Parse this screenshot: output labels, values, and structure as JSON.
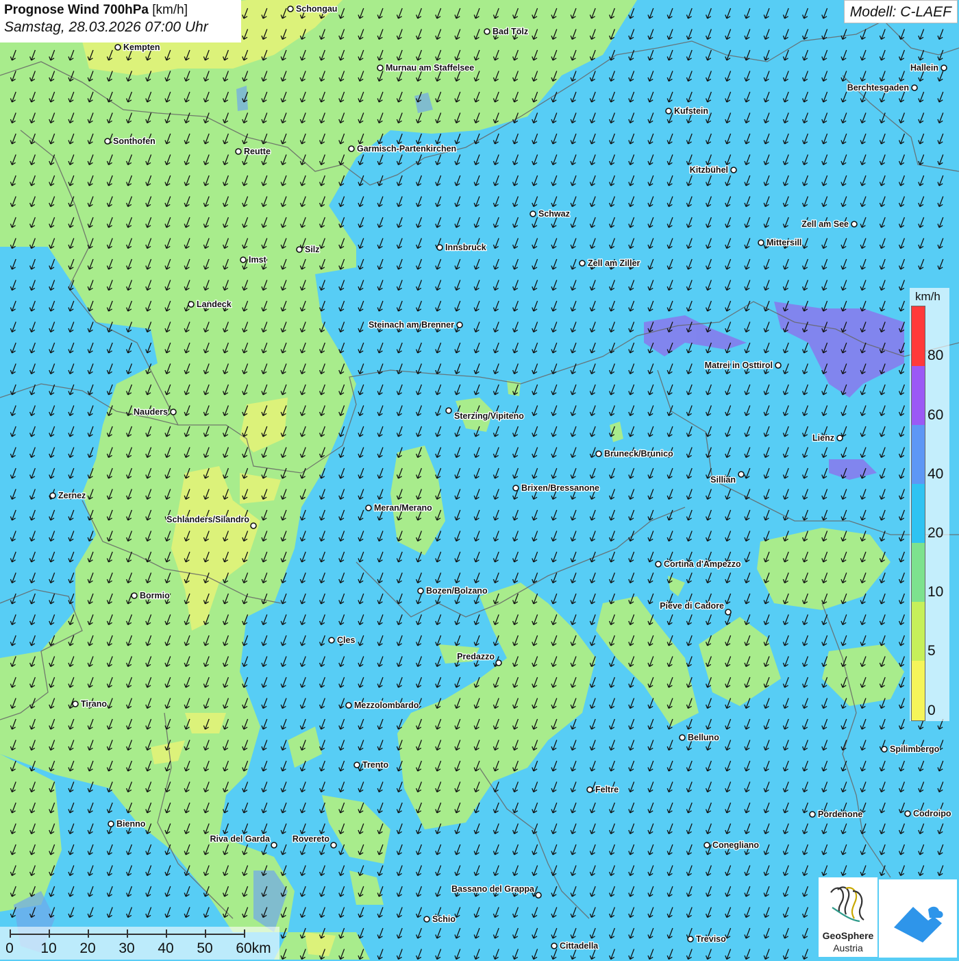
{
  "title": {
    "main": "Prognose Wind 700hPa",
    "unit": "[km/h]",
    "datetime": "Samstag, 28.03.2026 07:00 Uhr"
  },
  "model": "Modell: C-LAEF",
  "legend": {
    "unit": "km/h",
    "ticks": [
      "80",
      "60",
      "40",
      "20",
      "10",
      "5",
      "0"
    ],
    "colors": [
      "#ff3a3a",
      "#9b59f5",
      "#5d97f5",
      "#2fc3f2",
      "#7de28e",
      "#c6f05a",
      "#f5f55a"
    ]
  },
  "scalebar": {
    "labels": [
      "0",
      "10",
      "20",
      "30",
      "40",
      "50",
      "60km"
    ]
  },
  "logos": {
    "geosphere_line1": "GeoSphere",
    "geosphere_line2": "Austria"
  },
  "colors": {
    "wind_10_20": "#57cdf5",
    "wind_5_10": "#a8ec8c",
    "wind_0_5": "#dcf27a",
    "wind_40_60": "#8878ec"
  },
  "cities": [
    {
      "name": "Schongau"
    },
    {
      "name": "Kempten"
    },
    {
      "name": "Bad Tölz"
    },
    {
      "name": "Murnau am Staffelsee"
    },
    {
      "name": "Hallein"
    },
    {
      "name": "Berchtesgaden"
    },
    {
      "name": "Kufstein"
    },
    {
      "name": "Sonthofen"
    },
    {
      "name": "Reutte"
    },
    {
      "name": "Garmisch-Partenkirchen"
    },
    {
      "name": "Kitzbühel"
    },
    {
      "name": "Schwaz"
    },
    {
      "name": "Zell am See"
    },
    {
      "name": "Mittersill"
    },
    {
      "name": "Innsbruck"
    },
    {
      "name": "Zell am Ziller"
    },
    {
      "name": "Imst"
    },
    {
      "name": "Silz"
    },
    {
      "name": "Landeck"
    },
    {
      "name": "Steinach am Brenner"
    },
    {
      "name": "Matrei in Osttirol"
    },
    {
      "name": "Nauders"
    },
    {
      "name": "Sterzing/Vipiteno"
    },
    {
      "name": "Lienz"
    },
    {
      "name": "Bruneck/Brunico"
    },
    {
      "name": "Sillian"
    },
    {
      "name": "Zernez"
    },
    {
      "name": "Brixen/Bressanone"
    },
    {
      "name": "Meran/Merano"
    },
    {
      "name": "Schlanders/Silandro"
    },
    {
      "name": "Cortina d'Ampezzo"
    },
    {
      "name": "Bozen/Bolzano"
    },
    {
      "name": "Bormio"
    },
    {
      "name": "Pieve di Cadore"
    },
    {
      "name": "Cles"
    },
    {
      "name": "Predazzo"
    },
    {
      "name": "Tirano"
    },
    {
      "name": "Mezzolombardo"
    },
    {
      "name": "Belluno"
    },
    {
      "name": "Spilimbergo"
    },
    {
      "name": "Trento"
    },
    {
      "name": "Feltre"
    },
    {
      "name": "Pordenone"
    },
    {
      "name": "Codroipo"
    },
    {
      "name": "Bienno"
    },
    {
      "name": "Riva del Garda"
    },
    {
      "name": "Rovereto"
    },
    {
      "name": "Conegliano"
    },
    {
      "name": "Bassano del Grappa"
    },
    {
      "name": "Schio"
    },
    {
      "name": "Treviso"
    },
    {
      "name": "Cittadella"
    }
  ]
}
